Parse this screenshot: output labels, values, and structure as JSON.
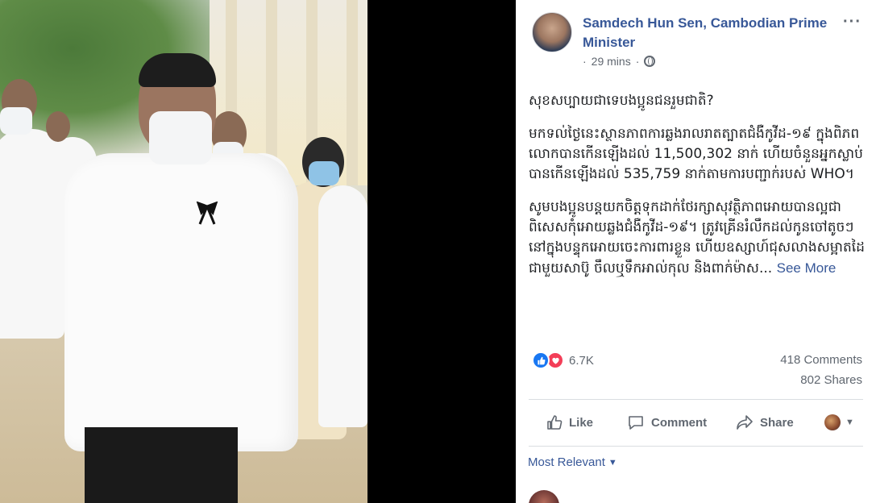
{
  "post": {
    "page_name": "Samdech Hun Sen, Cambodian Prime Minister",
    "time": "29 mins",
    "separator": "·",
    "more_icon": "···",
    "text_p1": "សុខសប្បាយជាទេបងប្អូនជនរួមជាតិ?",
    "text_p2": "មកទល់ថ្ងៃនេះស្ថានភាពការឆ្លងរាលរាតត្បាតជំងឺកូវីដ-១៩ ក្នុងពិភពលោកបានកើនឡើងដល់ 11,500,302 នាក់ ហើយចំនួនអ្នកស្លាប់បានកើនឡើងដល់ 535,759 នាក់តាមការបញ្ជាក់របស់ WHO។",
    "text_p3": "សូមបងប្អូនបន្តយកចិត្តទុកដាក់ថែរក្សាសុវត្ថិភាពអោយបានល្អជាពិសេសកុំអោយឆ្លងជំងឺកូវីដ-១៩។ ត្រូវគ្រើនរំលឹកដល់កូនចៅតូចៗនៅក្នុងបន្ទុកអោយចេះការពារខ្លួន ហើយឧស្សាហ៍ជុសលាងសម្អាតដៃជាមួយសាប៊ូ ចឹលឬទឹកអាល់កុល និងពាក់ម៉ាស...",
    "see_more": "See More"
  },
  "stats": {
    "reactions_count": "6.7K",
    "comments": "418 Comments",
    "shares": "802 Shares"
  },
  "actions": {
    "like": "Like",
    "comment": "Comment",
    "share": "Share"
  },
  "comments": {
    "sort_label": "Most Relevant"
  },
  "colors": {
    "link_blue": "#385898",
    "like_blue": "#1877f2",
    "love_red": "#f33e58",
    "muted": "#606770"
  }
}
